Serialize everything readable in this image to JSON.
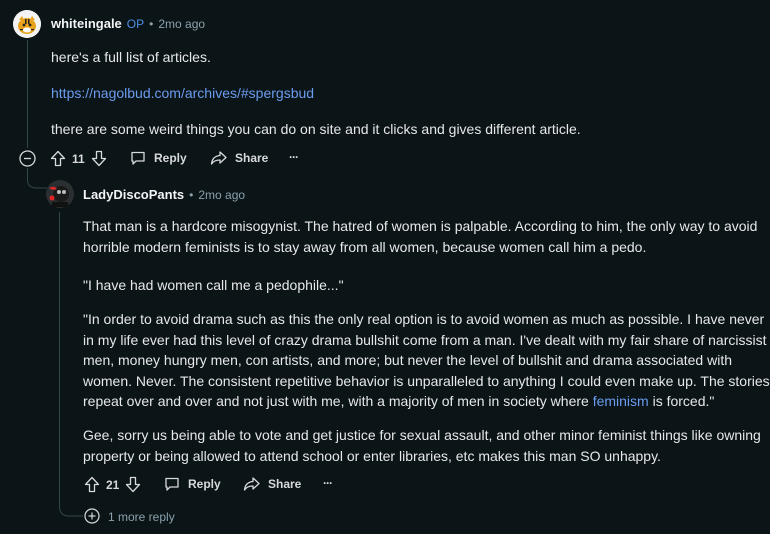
{
  "comment1": {
    "username": "whiteingale",
    "op_badge": "OP",
    "dot": "•",
    "time": "2mo ago",
    "paragraphs": [
      "here's a full list of articles.",
      "https://nagolbud.com/archives/#spergsbud",
      "there are some weird things you can do on site and it clicks and gives different article."
    ],
    "votes": "11",
    "reply_label": "Reply",
    "share_label": "Share",
    "more_label": "···"
  },
  "comment2": {
    "username": "LadyDiscoPants",
    "dot": "•",
    "time": "2mo ago",
    "p1_lines": [
      "That man is a hardcore misogynist. The hatred of women is palpable. According to him, the only way to avoid",
      "horrible modern feminists is to stay away from all women, because women call him a pedo."
    ],
    "p2": "\"I have had women call me a pedophile...\"",
    "p3_lines": [
      "\"In order to avoid drama such as this the only real option is to avoid women as much as possible. I have never",
      "in my life ever had this level of crazy drama bullshit come from a man. I've dealt with my fair share of narcissist",
      "men, money hungry men, con artists, and more; but never the level of bullshit and drama associated with",
      "women. Never. The consistent repetitive behavior is unparalleled to anything I could even make up. The stories"
    ],
    "p3_last_before": "repeat over and over and not just with me, with a majority of men in society where ",
    "p3_link": "feminism",
    "p3_last_after": " is forced.\"",
    "p4_lines": [
      "Gee, sorry us being able to vote and get justice for sexual assault, and other minor feminist things like owning",
      "property or being allowed to attend school or enter libraries, etc makes this man SO unhappy."
    ],
    "votes": "21",
    "reply_label": "Reply",
    "share_label": "Share",
    "more_label": "···"
  },
  "more_replies": "1 more reply"
}
